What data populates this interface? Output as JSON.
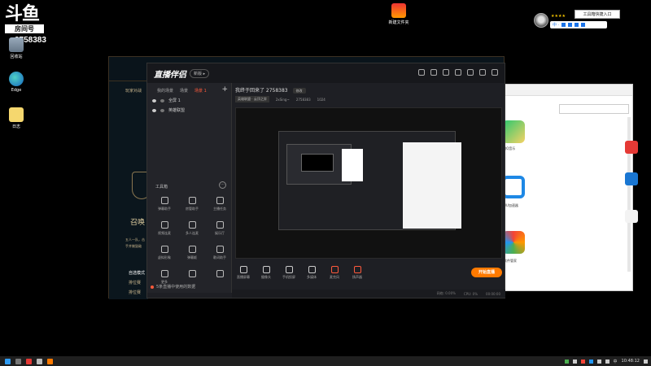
{
  "desktop": {
    "logo_text": "斗鱼",
    "logo_room": "房间号",
    "room_id": "2758383",
    "icons": [
      {
        "label": "回收站",
        "name": "recycle-bin"
      },
      {
        "label": "Edge",
        "name": "edge"
      },
      {
        "label": "日志",
        "name": "notes"
      },
      {
        "label": "新建文件夹",
        "name": "folder"
      }
    ]
  },
  "widget": {
    "stars": "★★★★",
    "ime_badge": "工具箱快捷入口",
    "ime_bar": "中 ·"
  },
  "app": {
    "title": "直播伴侣",
    "version": "新版 ▸",
    "tabs": [
      {
        "label": "我的场景",
        "active": false
      },
      {
        "label": "场景",
        "active": false
      },
      {
        "label": "场景 1",
        "active": true
      }
    ],
    "scenes": [
      {
        "label": "全屏 1"
      },
      {
        "label": "英雄联盟"
      }
    ],
    "room_title": "我终于回来了 2758383",
    "edit_label": "修改",
    "category": "英雄联盟 · 云顶之弈",
    "meta": [
      "2xSing~",
      "2758383",
      "1024"
    ],
    "toolbox_title": "工具箱",
    "tools": [
      {
        "label": "弹幕助手"
      },
      {
        "label": "房管助手"
      },
      {
        "label": "主播任务"
      },
      {
        "label": "视频连麦"
      },
      {
        "label": "多人连麦"
      },
      {
        "label": "娱乐厅"
      },
      {
        "label": "虚拟形象"
      },
      {
        "label": "弹幕姬"
      },
      {
        "label": "歌词助手"
      },
      {
        "label": "更多"
      },
      {
        "label": ""
      },
      {
        "label": ""
      }
    ],
    "footer": "5条直播中使用的数据",
    "bottom_tools": [
      {
        "label": "直播屏幕"
      },
      {
        "label": "摄像头"
      },
      {
        "label": "手机投屏"
      },
      {
        "label": "多媒体"
      },
      {
        "label": "麦克风",
        "red": true
      },
      {
        "label": "扬声器",
        "red": true
      }
    ],
    "start_label": "开始直播",
    "status": [
      "网络: 0.00%",
      "CPU: 0%",
      "00:00:00"
    ]
  },
  "lol": {
    "text1": "玩家对战",
    "text2": "召唤",
    "text3": "五人一队，击",
    "text4": "手并摧毁敌",
    "text5": "自选模式",
    "text6": "排位赛",
    "text7": "排位赛"
  },
  "browser": {
    "app1_label": "QQ音乐",
    "app2_label": "UU加速器",
    "app3_label": "软件管家"
  },
  "taskbar": {
    "time": "10:48:12",
    "lang": "中"
  },
  "colors": {
    "accent": "#ff7a00",
    "active_tab": "#ff5a3c"
  }
}
